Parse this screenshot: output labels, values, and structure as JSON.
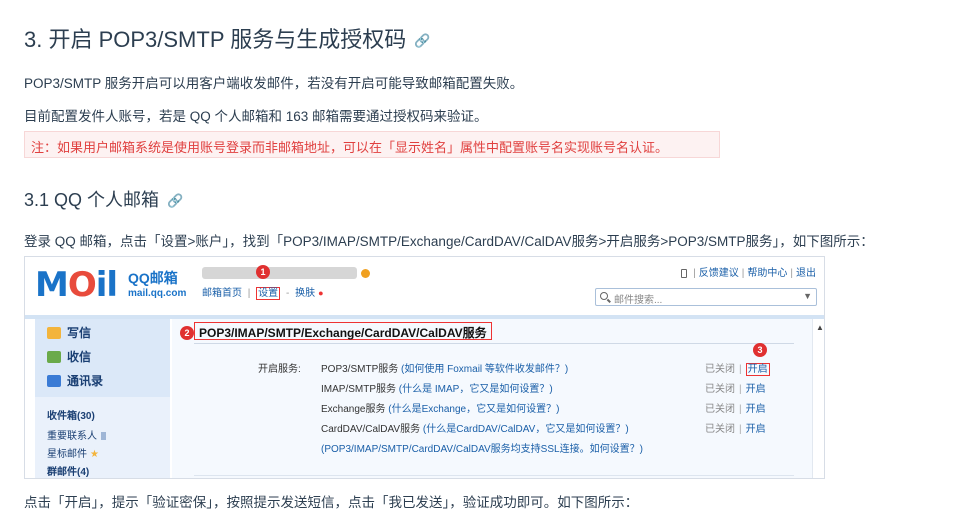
{
  "heading_main": "3. 开启 POP3/SMTP 服务与生成授权码",
  "heading_sub": "3.1 QQ 个人邮箱",
  "anchor_icon": "link-icon",
  "para1": "POP3/SMTP 服务开启可以用客户端收发邮件，若没有开启可能导致邮箱配置失败。",
  "para2": "目前配置发件人账号，若是 QQ 个人邮箱和 163 邮箱需要通过授权码来验证。",
  "note": "注：如果用户邮箱系统是使用账号登录而非邮箱地址，可以在「显示姓名」属性中配置账号名实现账号名认证。",
  "para3": "登录 QQ 邮箱，点击「设置>账户」，找到「POP3/IMAP/SMTP/Exchange/CardDAV/CalDAV服务>开启服务>POP3/SMTP服务」，如下图所示：",
  "para4": "点击「开启」，提示「验证密保」，按照提示发送短信，点击「我已发送」，验证成功即可。如下图所示：",
  "screenshot": {
    "logo_text": "MOil",
    "brand": "QQ邮箱",
    "brand_sub": "mail.qq.com",
    "nav": {
      "home": "邮箱首页",
      "settings": "设置",
      "sep1": "|",
      "sep2": "-",
      "skin": "换肤"
    },
    "badges": [
      "1",
      "2",
      "3"
    ],
    "top_links": {
      "feedback": "反馈建议",
      "help": "帮助中心",
      "logout": "退出"
    },
    "search_placeholder": "邮件搜索...",
    "sidebar": {
      "compose": "写信",
      "inbox": "收信",
      "contacts": "通讯录",
      "inbox_folder": "收件箱(30)",
      "vip": "重要联系人",
      "starred": "星标邮件",
      "groups": "群邮件(4)"
    },
    "section_title": "POP3/IMAP/SMTP/Exchange/CardDAV/CalDAV服务",
    "label_open": "开启服务:",
    "services": [
      {
        "name": "POP3/SMTP服务",
        "hint": "(如何使用 Foxmail 等软件收发邮件？)",
        "status": "已关闭",
        "action": "开启"
      },
      {
        "name": "IMAP/SMTP服务",
        "hint": "(什么是 IMAP，它又是如何设置？)",
        "status": "已关闭",
        "action": "开启"
      },
      {
        "name": "Exchange服务",
        "hint": "(什么是Exchange，它又是如何设置？)",
        "status": "已关闭",
        "action": "开启"
      },
      {
        "name": "CardDAV/CalDAV服务",
        "hint": "(什么是CardDAV/CalDAV，它又是如何设置？)",
        "status": "已关闭",
        "action": "开启"
      }
    ],
    "ssl_note": "(POP3/IMAP/SMTP/CardDAV/CalDAV服务均支持SSL连接。如何设置？)",
    "divider": "|"
  },
  "colors": {
    "text": "#2c3e50",
    "note_red": "#e0403f",
    "note_bg": "#fdf2f2",
    "link": "#1a5fa8",
    "highlight": "#e33333"
  }
}
